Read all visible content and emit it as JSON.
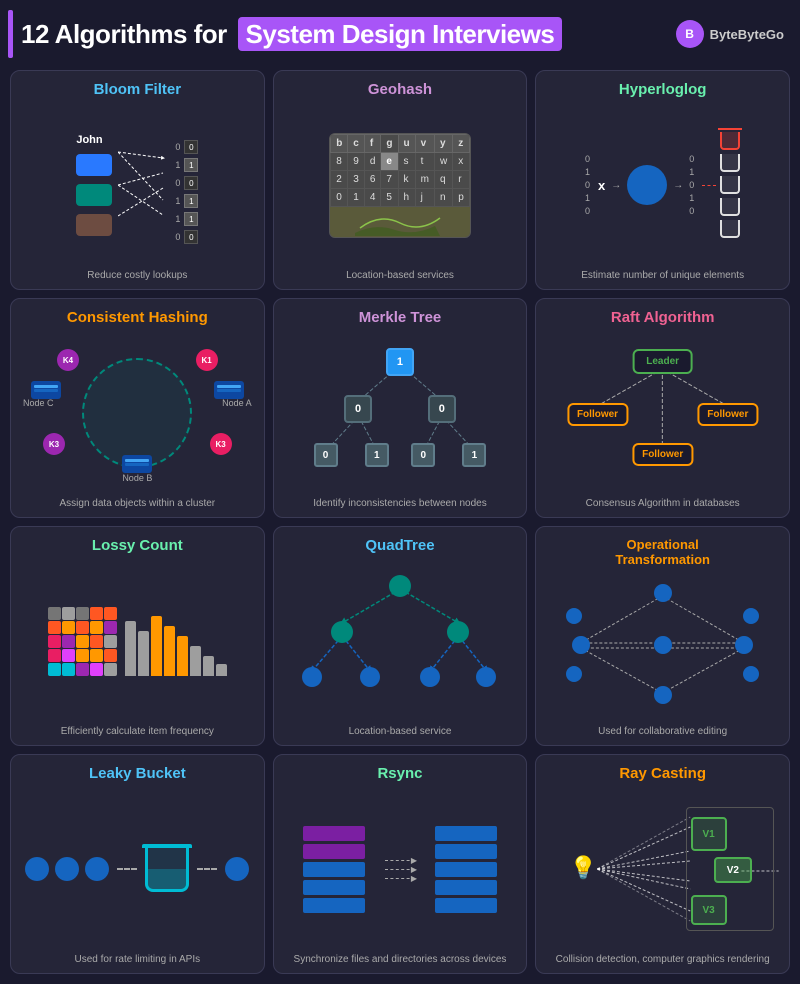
{
  "header": {
    "title_part1": "12 Algorithms for",
    "title_highlight": "System Design Interviews",
    "brand_name": "ByteByteGo"
  },
  "cards": [
    {
      "id": "bloom-filter",
      "title": "Bloom Filter",
      "title_color": "#4fc3f7",
      "description": "Reduce costly lookups"
    },
    {
      "id": "geohash",
      "title": "Geohash",
      "title_color": "#ce93d8",
      "description": "Location-based services"
    },
    {
      "id": "hyperloglog",
      "title": "Hyperloglog",
      "title_color": "#69f0ae",
      "description": "Estimate number of unique elements"
    },
    {
      "id": "consistent-hashing",
      "title": "Consistent Hashing",
      "title_color": "#ff9800",
      "description": "Assign data objects within a cluster"
    },
    {
      "id": "merkle-tree",
      "title": "Merkle Tree",
      "title_color": "#ce93d8",
      "description": "Identify inconsistencies between nodes"
    },
    {
      "id": "raft-algorithm",
      "title": "Raft Algorithm",
      "title_color": "#f06292",
      "description": "Consensus Algorithm in databases"
    },
    {
      "id": "lossy-count",
      "title": "Lossy Count",
      "title_color": "#69f0ae",
      "description": "Efficiently calculate item frequency"
    },
    {
      "id": "quadtree",
      "title": "QuadTree",
      "title_color": "#4fc3f7",
      "description": "Location-based service"
    },
    {
      "id": "operational-transformation",
      "title": "Operational Transformation",
      "title_color": "#ff9800",
      "description": "Used for collaborative editing"
    },
    {
      "id": "leaky-bucket",
      "title": "Leaky Bucket",
      "title_color": "#4fc3f7",
      "description": "Used for rate limiting in APIs"
    },
    {
      "id": "rsync",
      "title": "Rsync",
      "title_color": "#69f0ae",
      "description": "Synchronize files and directories across devices"
    },
    {
      "id": "ray-casting",
      "title": "Ray Casting",
      "title_color": "#ff9800",
      "description": "Collision detection, computer graphics rendering"
    }
  ],
  "bloom": {
    "label": "John",
    "boxes": [
      "blue",
      "teal",
      "brown"
    ],
    "bits": [
      "0",
      "1",
      "0",
      "1",
      "1",
      "0"
    ]
  },
  "geohash": {
    "headers": [
      "b",
      "c",
      "f",
      "g",
      "u",
      "v",
      "y",
      "z"
    ],
    "rows": [
      [
        "8",
        "9",
        "d",
        "e",
        "s",
        "t",
        "w",
        "x"
      ],
      [
        "2",
        "3",
        "6",
        "7",
        "k",
        "m",
        "q",
        "r"
      ],
      [
        "0",
        "1",
        "4",
        "5",
        "h",
        "j",
        "n",
        "p"
      ]
    ]
  },
  "merkle": {
    "root": "1",
    "level1": [
      "0",
      "0"
    ],
    "level2": [
      "0",
      "1",
      "0",
      "1"
    ]
  },
  "raft": {
    "leader": "Leader",
    "followers": [
      "Follower",
      "Follower",
      "Follower"
    ]
  },
  "raycasting": {
    "boxes": [
      "V1",
      "V2",
      "V3"
    ]
  }
}
